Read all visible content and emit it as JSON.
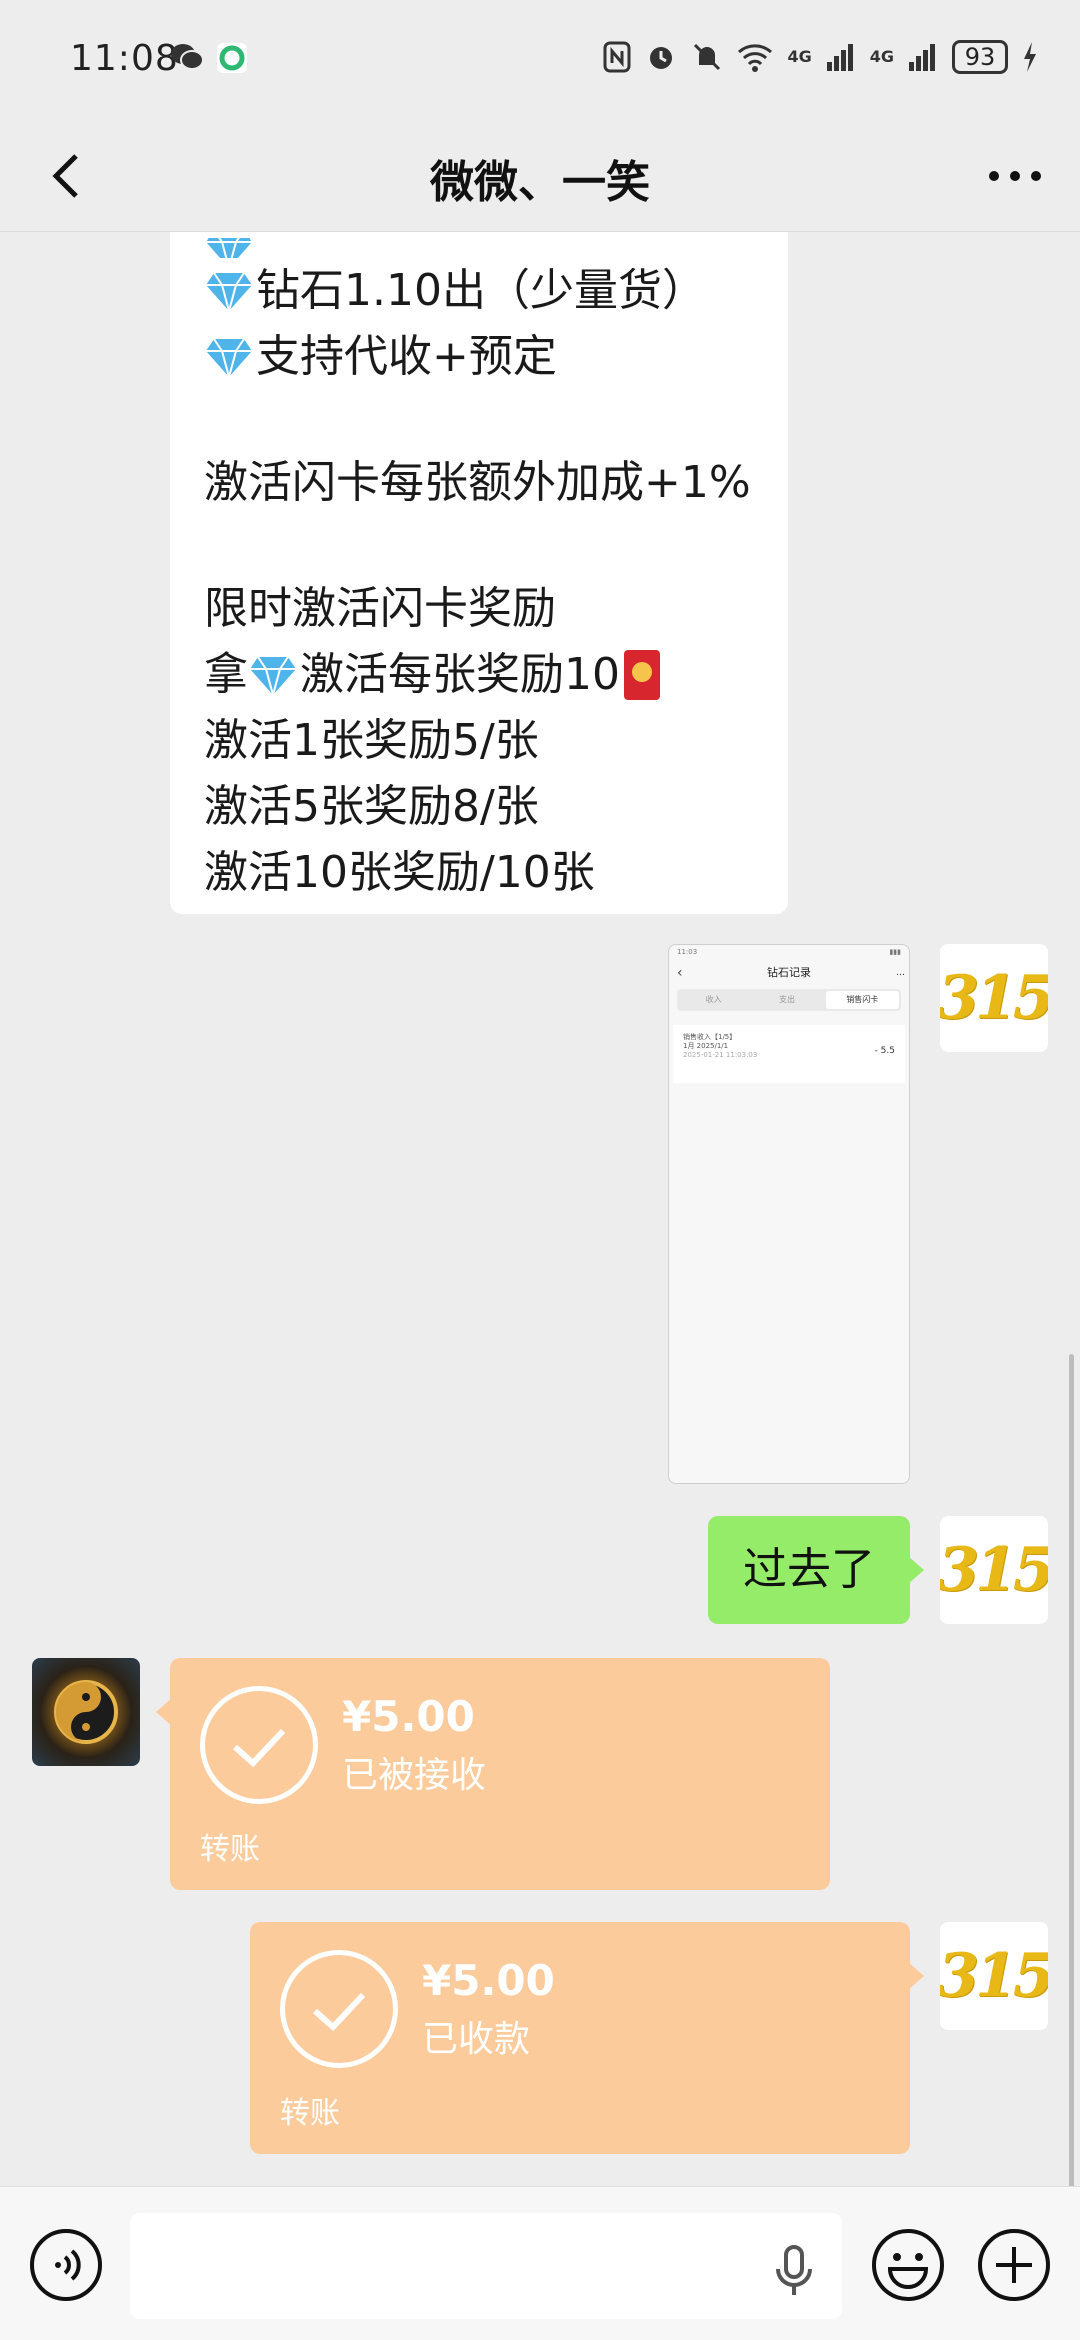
{
  "status_bar": {
    "time": "11:08",
    "battery": "93",
    "net_label_1": "4G",
    "net_label_2": "4G"
  },
  "header": {
    "title": "微微、一笑"
  },
  "messages": {
    "promo": {
      "line_partial": "",
      "line1": "钻石1.10出（少量货）",
      "line2": "支持代收+预定",
      "line3": "激活闪卡每张额外加成+1%",
      "line4": "限时激活闪卡奖励",
      "line5_a": "拿",
      "line5_b": "激活每张奖励10",
      "line6": "激活1张奖励5/张",
      "line7": "激活5张奖励8/张",
      "line8": "激活10张奖励/10张"
    },
    "screenshot": {
      "title": "钻石记录",
      "tabs": [
        "收入",
        "支出",
        "销售闪卡"
      ],
      "card_line1": "销售收入【1/5】",
      "card_line2": "1月 2025/1/1",
      "card_line3": "2025-01-21 11:03:03",
      "amount": "- 5.5"
    },
    "sent_text": "过去了",
    "transfer_received": {
      "amount": "¥5.00",
      "status": "已被接收",
      "label": "转账"
    },
    "transfer_sent": {
      "amount": "¥5.00",
      "status": "已收款",
      "label": "转账"
    },
    "avatar_text": "315"
  },
  "colors": {
    "background": "#ededed",
    "green_bubble": "#95ec69",
    "transfer_bubble": "#fbcb9c",
    "avatar_gold": "#e8b817"
  },
  "icons": {
    "back": "chevron-left-icon",
    "more": "more-dots-icon",
    "voice": "voice-icon",
    "mic": "microphone-icon",
    "emoji": "emoji-icon",
    "plus": "plus-icon",
    "check": "check-circle-icon",
    "gem": "diamond-icon"
  }
}
